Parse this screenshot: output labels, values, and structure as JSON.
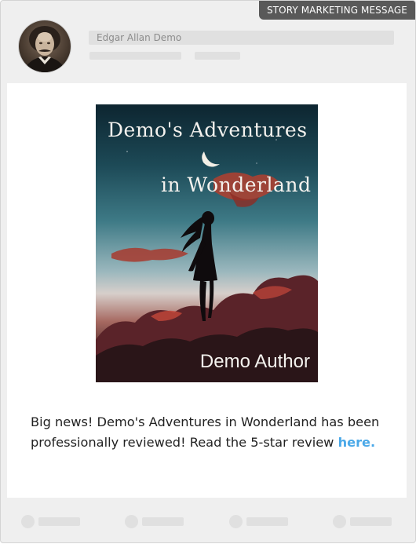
{
  "badge": {
    "label": "STORY MARKETING MESSAGE"
  },
  "author": {
    "name": "Edgar Allan Demo"
  },
  "cover": {
    "title_line1": "Demo's Adventures",
    "title_line2": "in Wonderland",
    "author": "Demo Author"
  },
  "message": {
    "text": "Big news! Demo's Adventures in Wonderland has been professionally reviewed! Read the 5-star review ",
    "link_text": "here."
  },
  "footer": {
    "actions": [
      "action-1",
      "action-2",
      "action-3",
      "action-4"
    ]
  },
  "colors": {
    "card_bg": "#efefef",
    "badge_bg": "#595959",
    "link": "#4aa8e8",
    "placeholder": "#e0e0e0"
  },
  "icons": {
    "avatar": "author-portrait",
    "moon": "crescent-moon-icon"
  }
}
